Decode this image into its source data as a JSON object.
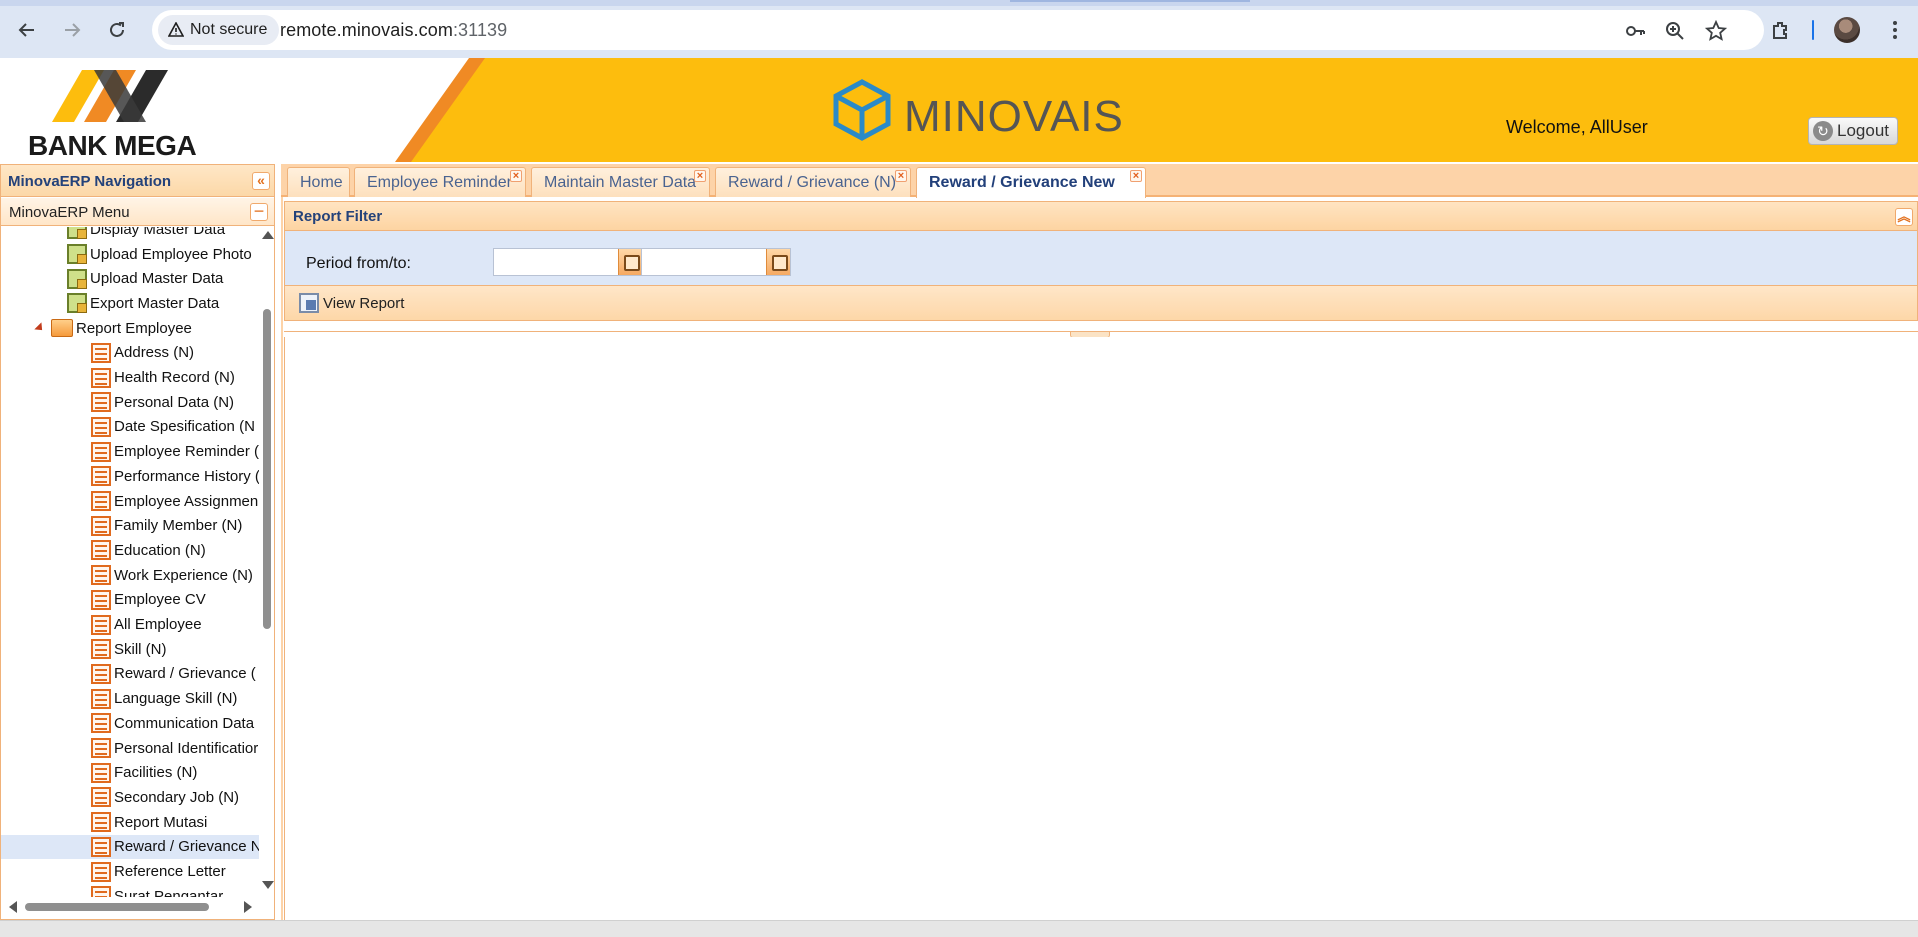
{
  "browser": {
    "security_label": "Not secure",
    "url_host": "remote.minovais.com",
    "url_port": ":31139",
    "icons": [
      "back-icon",
      "forward-icon",
      "reload-icon",
      "key-icon",
      "zoom-icon",
      "star-icon",
      "extensions-icon",
      "kebab-menu-icon"
    ]
  },
  "header": {
    "bank_logo_word1": "BANK",
    "bank_logo_word2": "MEGA",
    "brand_name": "MINOVAIS",
    "welcome_text": "Welcome, AllUser",
    "logout_label": "Logout",
    "colors": {
      "primary": "#fdbd0d",
      "accent": "#f08a24"
    }
  },
  "nav": {
    "title": "MinovaERP Navigation",
    "menu_title": "MinovaERP Menu",
    "items": [
      {
        "label": "Display Master Data",
        "level": 2,
        "icon": "page-icon",
        "selected": false
      },
      {
        "label": "Upload Employee Photo",
        "level": 2,
        "icon": "page-icon",
        "selected": false
      },
      {
        "label": "Upload Master Data",
        "level": 2,
        "icon": "page-icon",
        "selected": false
      },
      {
        "label": "Export Master Data",
        "level": 2,
        "icon": "page-icon",
        "selected": false
      },
      {
        "label": "Report Employee",
        "level": 1,
        "icon": "folder-icon",
        "selected": false,
        "expanded": true
      },
      {
        "label": "Address (N)",
        "level": 3,
        "icon": "report-icon",
        "selected": false
      },
      {
        "label": "Health Record (N)",
        "level": 3,
        "icon": "report-icon",
        "selected": false
      },
      {
        "label": "Personal Data (N)",
        "level": 3,
        "icon": "report-icon",
        "selected": false
      },
      {
        "label": "Date Spesification (N",
        "level": 3,
        "icon": "report-icon",
        "selected": false
      },
      {
        "label": "Employee Reminder (",
        "level": 3,
        "icon": "report-icon",
        "selected": false
      },
      {
        "label": "Performance History (",
        "level": 3,
        "icon": "report-icon",
        "selected": false
      },
      {
        "label": "Employee Assignmen",
        "level": 3,
        "icon": "report-icon",
        "selected": false
      },
      {
        "label": "Family Member (N)",
        "level": 3,
        "icon": "report-icon",
        "selected": false
      },
      {
        "label": "Education (N)",
        "level": 3,
        "icon": "report-icon",
        "selected": false
      },
      {
        "label": "Work Experience (N)",
        "level": 3,
        "icon": "report-icon",
        "selected": false
      },
      {
        "label": "Employee CV",
        "level": 3,
        "icon": "report-icon",
        "selected": false
      },
      {
        "label": "All Employee",
        "level": 3,
        "icon": "report-icon",
        "selected": false
      },
      {
        "label": "Skill (N)",
        "level": 3,
        "icon": "report-icon",
        "selected": false
      },
      {
        "label": "Reward / Grievance (",
        "level": 3,
        "icon": "report-icon",
        "selected": false
      },
      {
        "label": "Language Skill (N)",
        "level": 3,
        "icon": "report-icon",
        "selected": false
      },
      {
        "label": "Communication Data",
        "level": 3,
        "icon": "report-icon",
        "selected": false
      },
      {
        "label": "Personal Identificatior",
        "level": 3,
        "icon": "report-icon",
        "selected": false
      },
      {
        "label": "Facilities (N)",
        "level": 3,
        "icon": "report-icon",
        "selected": false
      },
      {
        "label": "Secondary Job (N)",
        "level": 3,
        "icon": "report-icon",
        "selected": false
      },
      {
        "label": "Report Mutasi",
        "level": 3,
        "icon": "report-icon",
        "selected": false
      },
      {
        "label": "Reward / Grievance N",
        "level": 3,
        "icon": "report-icon",
        "selected": true
      },
      {
        "label": "Reference Letter",
        "level": 3,
        "icon": "report-icon",
        "selected": false
      },
      {
        "label": "Surat Pengantar",
        "level": 3,
        "icon": "report-icon",
        "selected": false
      }
    ]
  },
  "tabs": [
    {
      "label": "Home",
      "closable": false,
      "active": false
    },
    {
      "label": "Employee Reminder",
      "closable": true,
      "active": false
    },
    {
      "label": "Maintain Master Data",
      "closable": true,
      "active": false
    },
    {
      "label": "Reward / Grievance (N)",
      "closable": true,
      "active": false
    },
    {
      "label": "Reward / Grievance New",
      "closable": true,
      "active": true
    }
  ],
  "report_filter": {
    "title": "Report Filter",
    "period_label": "Period from/to:",
    "period_from": {
      "value": "",
      "placeholder": ""
    },
    "period_to": {
      "value": "",
      "placeholder": ""
    },
    "view_report_label": "View Report"
  }
}
